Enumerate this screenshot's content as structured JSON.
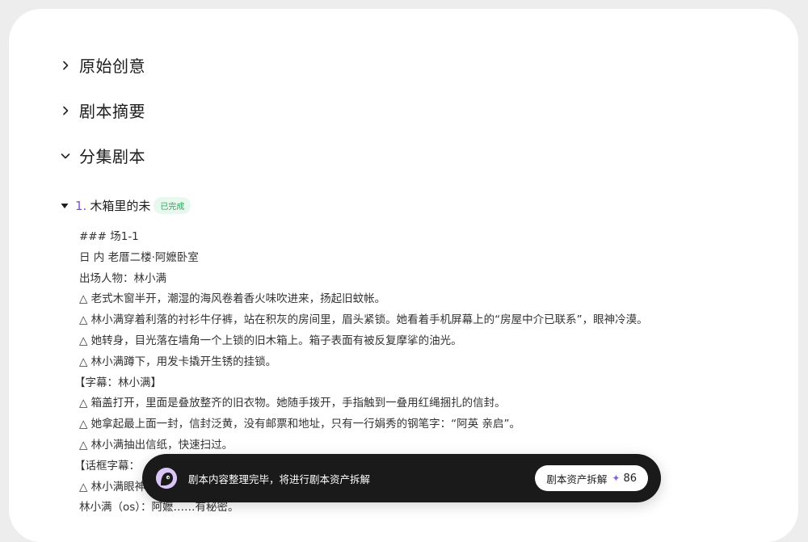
{
  "sections": [
    {
      "title": "原始创意",
      "expanded": false,
      "icon": "chevron-right-icon"
    },
    {
      "title": "剧本摘要",
      "expanded": false,
      "icon": "chevron-right-icon"
    },
    {
      "title": "分集剧本",
      "expanded": true,
      "icon": "chevron-down-icon"
    }
  ],
  "episode": {
    "number": "1.",
    "title": "木箱里的未",
    "status": "已完成",
    "status_color": "#2fa55a",
    "number_color": "#7b4fe0"
  },
  "script_lines": [
    "### 场1-1",
    "日 内 老厝二楼·阿嬷卧室",
    "出场人物：林小满",
    "△ 老式木窗半开，潮湿的海风卷着香火味吹进来，扬起旧蚊帐。",
    "△ 林小满穿着利落的衬衫牛仔裤，站在积灰的房间里，眉头紧锁。她看着手机屏幕上的“房屋中介已联系”，眼神冷漠。",
    "△ 她转身，目光落在墙角一个上锁的旧木箱上。箱子表面有被反复摩挲的油光。",
    "△ 林小满蹲下，用发卡撬开生锈的挂锁。",
    "【字幕：林小满】",
    "△ 箱盖打开，里面是叠放整齐的旧衣物。她随手拨开，手指触到一叠用红绳捆扎的信封。",
    "△ 她拿起最上面一封，信封泛黄，没有邮票和地址，只有一行娟秀的钢笔字：“阿英 亲启”。",
    "△ 林小满抽出信纸，快速扫过。",
    "【话框字幕：",
    "△ 林小满眼神",
    "林小满（os）：阿嬷……有秘密。"
  ],
  "toast": {
    "message": "剧本内容整理完毕，将进行剧本资产拆解",
    "button_label": "剧本资产拆解",
    "cost": "86",
    "accent_color": "#8a5cf0"
  }
}
